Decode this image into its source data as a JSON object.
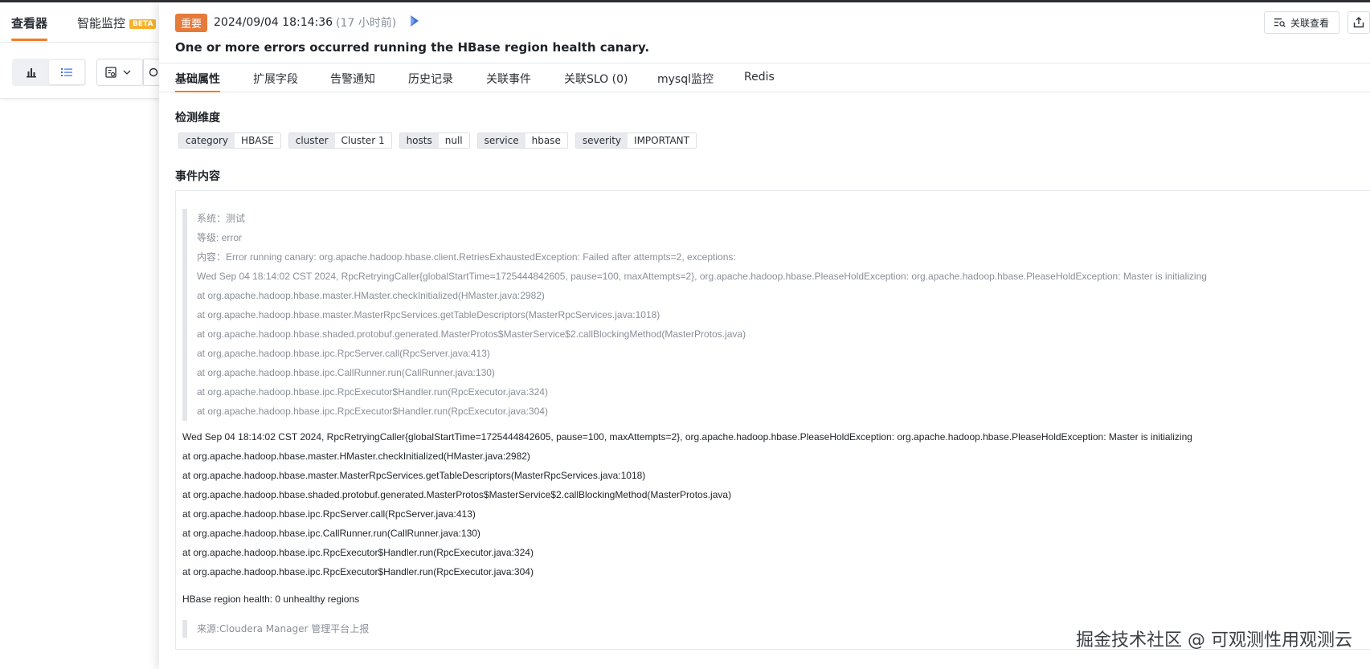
{
  "left_panel": {
    "tabs": [
      {
        "label": "查看器"
      },
      {
        "label": "智能监控",
        "badge": "BETA"
      }
    ]
  },
  "event": {
    "level_badge": "重要",
    "timestamp": "2024/09/04 18:14:36",
    "relative_time": "(17 小时前)",
    "title": "One or more errors occurred running the HBase region health canary."
  },
  "actions": {
    "related_view_label": "关联查看"
  },
  "tabs": [
    {
      "label": "基础属性"
    },
    {
      "label": "扩展字段"
    },
    {
      "label": "告警通知"
    },
    {
      "label": "历史记录"
    },
    {
      "label": "关联事件"
    },
    {
      "label": "关联SLO (0)"
    },
    {
      "label": "mysql监控"
    },
    {
      "label": "Redis"
    }
  ],
  "dimensions": {
    "title": "检测维度",
    "tags": [
      {
        "key": "category",
        "value": "HBASE"
      },
      {
        "key": "cluster",
        "value": "Cluster 1"
      },
      {
        "key": "hosts",
        "value": "null"
      },
      {
        "key": "service",
        "value": "hbase"
      },
      {
        "key": "severity",
        "value": "IMPORTANT"
      }
    ]
  },
  "content": {
    "title": "事件内容",
    "quote_lines": [
      "系统：测试",
      "等级: error",
      "内容：Error running canary: org.apache.hadoop.hbase.client.RetriesExhaustedException: Failed after attempts=2, exceptions:",
      "Wed Sep 04 18:14:02 CST 2024, RpcRetryingCaller{globalStartTime=1725444842605, pause=100, maxAttempts=2}, org.apache.hadoop.hbase.PleaseHoldException: org.apache.hadoop.hbase.PleaseHoldException: Master is initializing",
      "at org.apache.hadoop.hbase.master.HMaster.checkInitialized(HMaster.java:2982)",
      "at org.apache.hadoop.hbase.master.MasterRpcServices.getTableDescriptors(MasterRpcServices.java:1018)",
      "at org.apache.hadoop.hbase.shaded.protobuf.generated.MasterProtos$MasterService$2.callBlockingMethod(MasterProtos.java)",
      "at org.apache.hadoop.hbase.ipc.RpcServer.call(RpcServer.java:413)",
      "at org.apache.hadoop.hbase.ipc.CallRunner.run(CallRunner.java:130)",
      "at org.apache.hadoop.hbase.ipc.RpcExecutor$Handler.run(RpcExecutor.java:324)",
      "at org.apache.hadoop.hbase.ipc.RpcExecutor$Handler.run(RpcExecutor.java:304)"
    ],
    "body_lines": [
      "Wed Sep 04 18:14:02 CST 2024, RpcRetryingCaller{globalStartTime=1725444842605, pause=100, maxAttempts=2}, org.apache.hadoop.hbase.PleaseHoldException: org.apache.hadoop.hbase.PleaseHoldException: Master is initializing",
      "at org.apache.hadoop.hbase.master.HMaster.checkInitialized(HMaster.java:2982)",
      "at org.apache.hadoop.hbase.master.MasterRpcServices.getTableDescriptors(MasterRpcServices.java:1018)",
      "at org.apache.hadoop.hbase.shaded.protobuf.generated.MasterProtos$MasterService$2.callBlockingMethod(MasterProtos.java)",
      "at org.apache.hadoop.hbase.ipc.RpcServer.call(RpcServer.java:413)",
      "at org.apache.hadoop.hbase.ipc.CallRunner.run(CallRunner.java:130)",
      "at org.apache.hadoop.hbase.ipc.RpcExecutor$Handler.run(RpcExecutor.java:324)",
      "at org.apache.hadoop.hbase.ipc.RpcExecutor$Handler.run(RpcExecutor.java:304)"
    ],
    "health_line": "HBase region health: 0 unhealthy regions",
    "source_line": "来源:Cloudera Manager 管理平台上报"
  },
  "watermark": "掘金技术社区 @ 可观测性用观测云",
  "colors": {
    "accent": "#f07c2a",
    "badge": "#e67a3a",
    "beta": "#f5b12d"
  },
  "icons": {
    "bar_chart": "bar-chart-icon",
    "list": "list-icon",
    "view_settings": "view-settings-icon",
    "search": "search-icon",
    "ai_assist": "ai-sparkle-icon",
    "related_view": "related-view-icon",
    "share": "share-icon"
  }
}
